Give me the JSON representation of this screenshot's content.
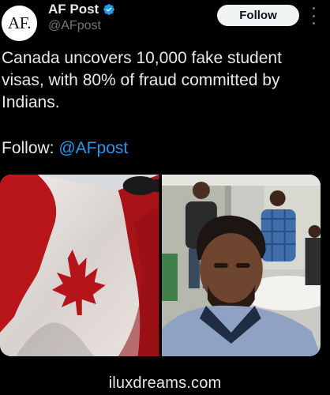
{
  "author": {
    "avatar_text": "AF.",
    "display_name": "AF Post",
    "handle": "@AFpost",
    "verified": true
  },
  "actions": {
    "follow_label": "Follow"
  },
  "tweet": {
    "text": "Canada uncovers 10,000 fake student visas, with 80% of fraud committed by Indians.",
    "follow_prefix": "Follow: ",
    "follow_mention": "@AFpost"
  },
  "media": [
    {
      "description_icon": "canadian-flag-photo"
    },
    {
      "description_icon": "group-of-men-photo"
    }
  ],
  "watermark": "iluxdreams.com",
  "colors": {
    "background": "#000000",
    "text": "#e7e9ea",
    "secondary_text": "#71767b",
    "link": "#1d9bf0",
    "verified": "#1d9bf0",
    "follow_button_bg": "#eff3f4"
  }
}
